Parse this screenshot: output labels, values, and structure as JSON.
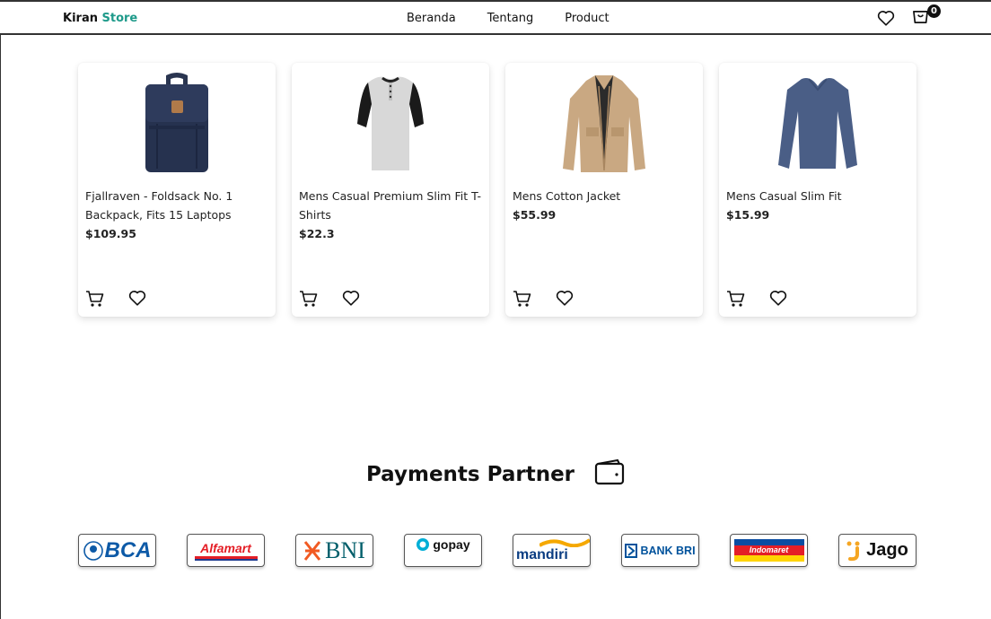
{
  "navbar": {
    "brand_part1": "Kiran",
    "brand_part2": "Store",
    "links": [
      "Beranda",
      "Tentang",
      "Product"
    ],
    "cart_count": "0"
  },
  "products": [
    {
      "name": "Fjallraven - Foldsack No. 1 Backpack, Fits 15 Laptops",
      "price": "$109.95",
      "image": "backpack-image"
    },
    {
      "name": "Mens Casual Premium Slim Fit T-Shirts",
      "price": "$22.3",
      "image": "tshirt-image"
    },
    {
      "name": "Mens Cotton Jacket",
      "price": "$55.99",
      "image": "jacket-image"
    },
    {
      "name": "Mens Casual Slim Fit",
      "price": "$15.99",
      "image": "longsleeve-image"
    }
  ],
  "payments": {
    "title": "Payments Partner",
    "partners": [
      "BCA",
      "Alfamart",
      "BNI",
      "gopay",
      "mandiri",
      "BANK BRI",
      "Indomaret",
      "Jago"
    ]
  },
  "colors": {
    "brand_accent": "#1e9a8a",
    "text": "#222222"
  }
}
